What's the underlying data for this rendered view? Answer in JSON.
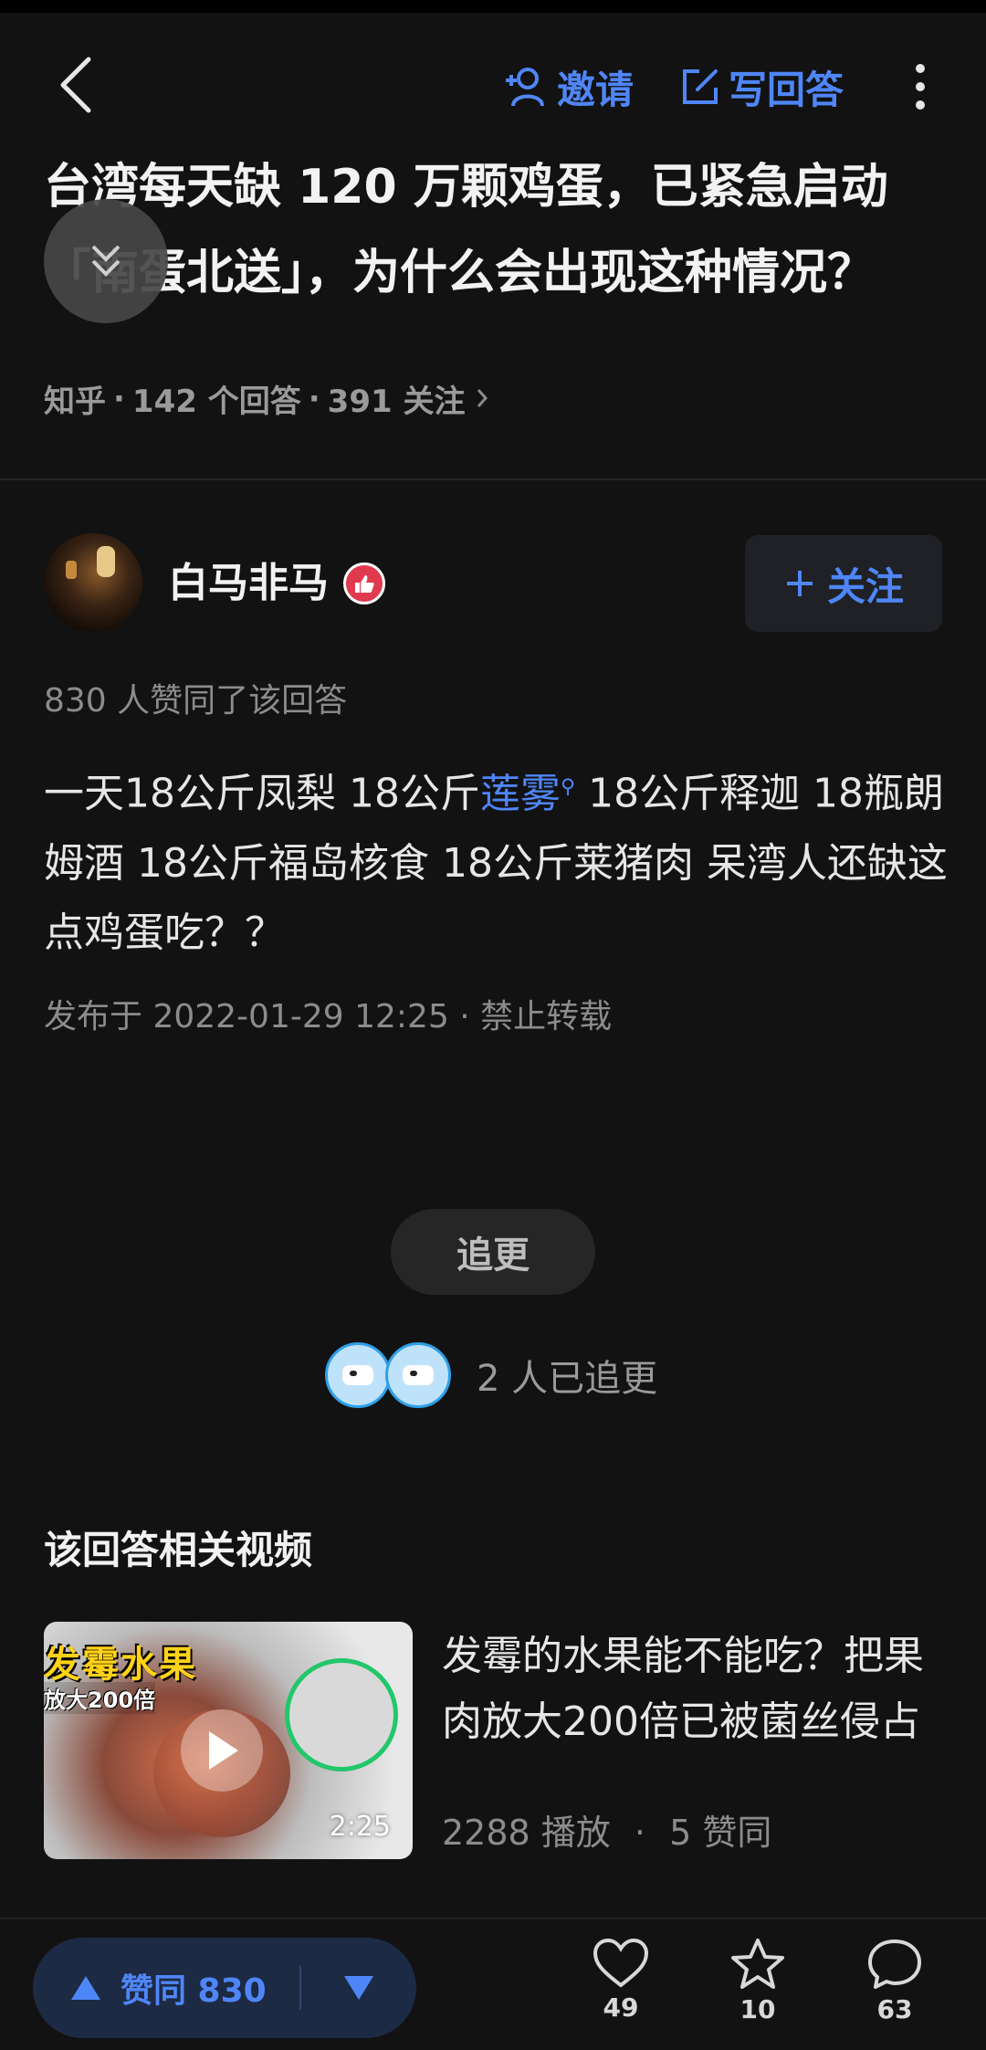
{
  "topbar": {
    "invite_label": "邀请",
    "write_answer_label": "写回答"
  },
  "question": {
    "title": "台湾每天缺 120 万颗鸡蛋，已紧急启动「南蛋北送」，为什么会出现这种情况？",
    "source": "知乎",
    "answers": "142 个回答",
    "follows": "391 关注"
  },
  "author": {
    "name": "白马非马",
    "follow_label": "关注"
  },
  "answer": {
    "upvote_summary": "830 人赞同了该回答",
    "body_before_link": "一天18公斤凤梨 18公斤",
    "link_text": "莲雾",
    "body_after_link": " 18公斤释迦 18瓶朗姆酒 18公斤福岛核食 18公斤莱猪肉 呆湾人还缺这点鸡蛋吃？？",
    "publish_info": "发布于 2022-01-29 12:25 · 禁止转载"
  },
  "followup": {
    "button_label": "追更",
    "followers_text": "2 人已追更"
  },
  "related": {
    "heading": "该回答相关视频",
    "video": {
      "thumb_text_1": "发霉水果",
      "thumb_text_2": "放大200倍",
      "duration": "2:25",
      "title": "发霉的水果能不能吃？把果肉放大200倍已被菌丝侵占",
      "plays": "2288 播放",
      "likes": "5 赞同"
    }
  },
  "bottombar": {
    "upvote_label": "赞同 830",
    "like_count": "49",
    "favorite_count": "10",
    "comment_count": "63"
  },
  "colors": {
    "accent": "#4f86f7",
    "background": "#121212"
  }
}
